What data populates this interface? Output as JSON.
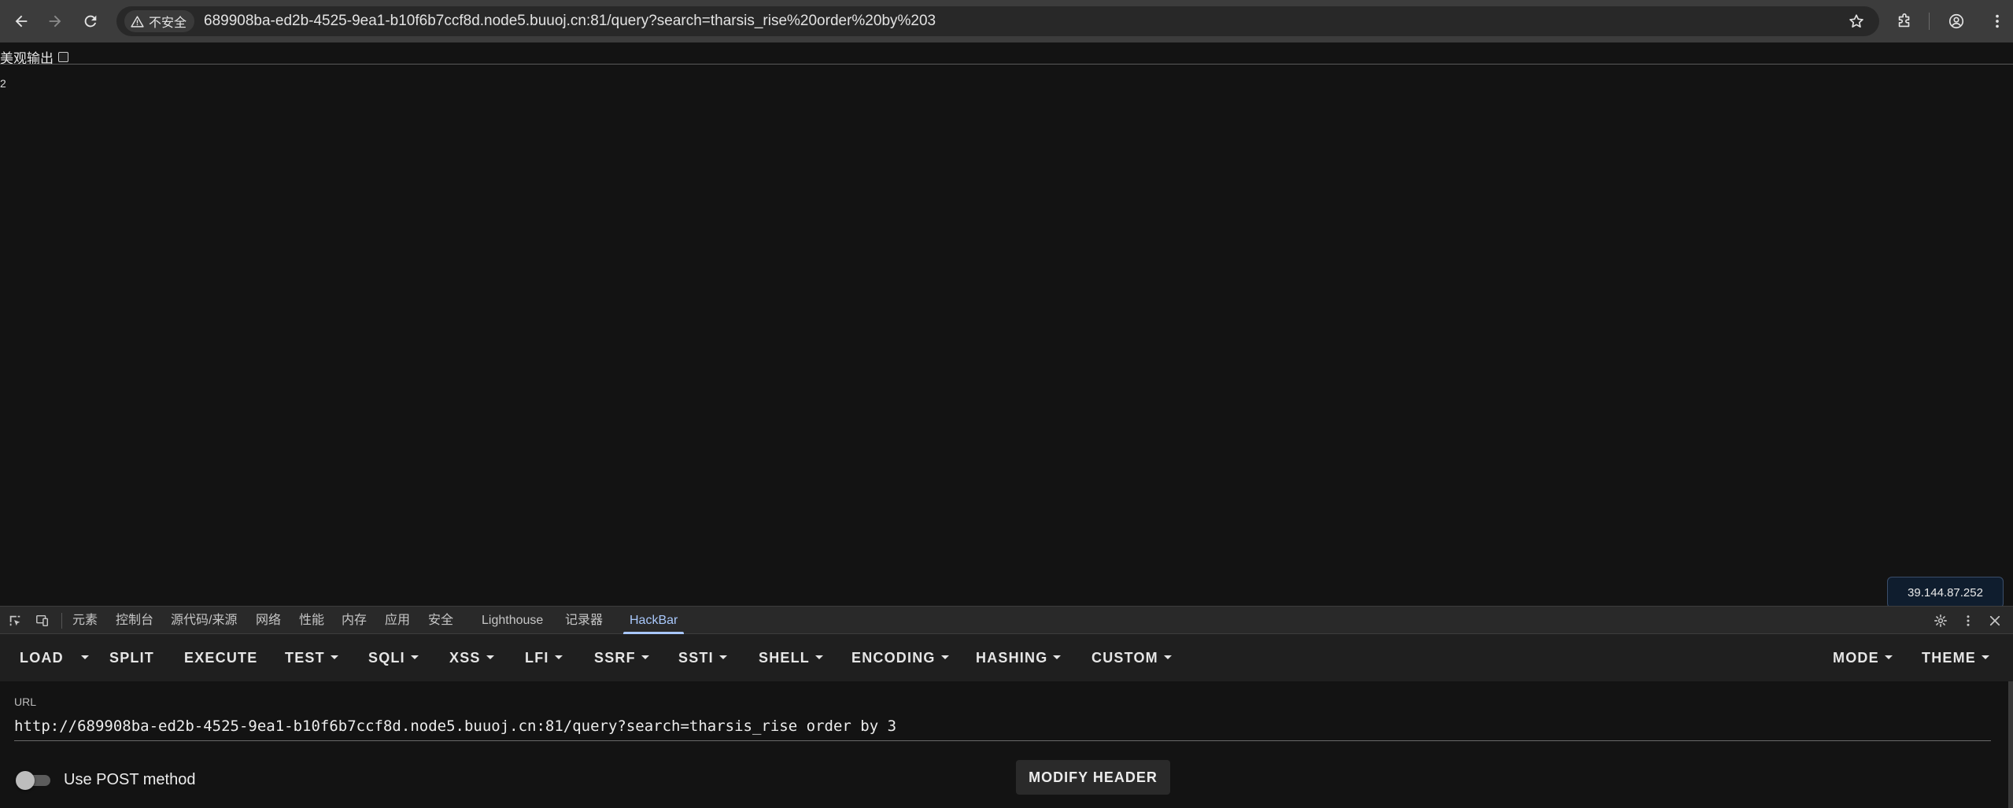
{
  "browser": {
    "security_label": "不安全",
    "address": "689908ba-ed2b-4525-9ea1-b10f6b7ccf8d.node5.buuoj.cn:81/query?search=tharsis_rise%20order%20by%203"
  },
  "page": {
    "pretty_print_label": "美观输出",
    "output": "2",
    "ip_badge": "39.144.87.252"
  },
  "devtools": {
    "tabs": [
      "元素",
      "控制台",
      "源代码/来源",
      "网络",
      "性能",
      "内存",
      "应用",
      "安全",
      "Lighthouse",
      "记录器",
      "HackBar"
    ],
    "active_tab": "HackBar"
  },
  "hackbar": {
    "menu": {
      "load": "LOAD",
      "split": "SPLIT",
      "execute": "EXECUTE",
      "test": "TEST",
      "sqli": "SQLI",
      "xss": "XSS",
      "lfi": "LFI",
      "ssrf": "SSRF",
      "ssti": "SSTI",
      "shell": "SHELL",
      "encoding": "ENCODING",
      "hashing": "HASHING",
      "custom": "CUSTOM",
      "mode": "MODE",
      "theme": "THEME"
    },
    "url_label": "URL",
    "url_value": "http://689908ba-ed2b-4525-9ea1-b10f6b7ccf8d.node5.buuoj.cn:81/query?search=tharsis_rise order by 3",
    "post_label": "Use POST method",
    "post_enabled": false,
    "modify_header": "MODIFY HEADER"
  }
}
